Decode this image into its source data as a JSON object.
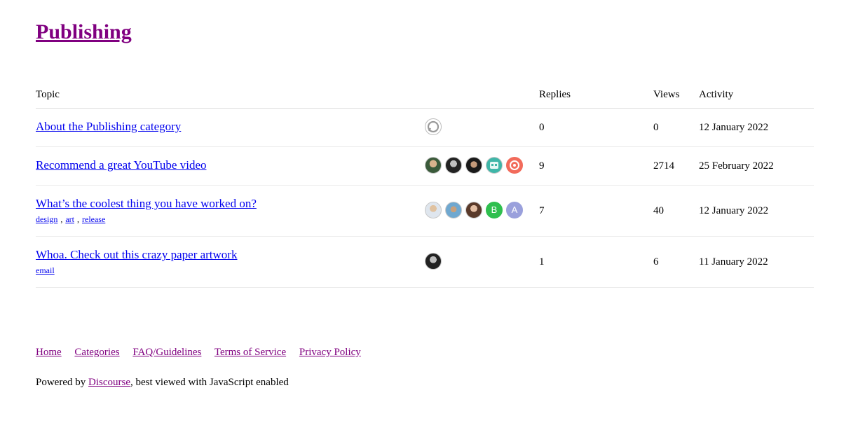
{
  "category": {
    "title": "Publishing"
  },
  "columns": {
    "topic": "Topic",
    "replies": "Replies",
    "views": "Views",
    "activity": "Activity"
  },
  "topics": [
    {
      "title": "About the Publishing category",
      "tags": [],
      "replies": "0",
      "views": "0",
      "activity": "12 January 2022",
      "posters": [
        "discourse-logo-avatar"
      ]
    },
    {
      "title": "Recommend a great YouTube video",
      "tags": [],
      "replies": "9",
      "views": "2714",
      "activity": "25 February 2022",
      "posters": [
        "user-photo-avatar",
        "user-photo-avatar",
        "user-photo-avatar",
        "robot-avatar",
        "coral-logo-avatar"
      ]
    },
    {
      "title": "What’s the coolest thing you have worked on?",
      "tags": [
        "design",
        "art",
        "release"
      ],
      "replies": "7",
      "views": "40",
      "activity": "12 January 2022",
      "posters": [
        "user-photo-avatar",
        "user-photo-avatar",
        "user-photo-avatar",
        "letter-avatar",
        "letter-avatar"
      ],
      "letters": [
        "B",
        "A"
      ]
    },
    {
      "title": "Whoa. Check out this crazy paper artwork",
      "tags": [
        "email"
      ],
      "replies": "1",
      "views": "6",
      "activity": "11 January 2022",
      "posters": [
        "user-photo-avatar"
      ]
    }
  ],
  "footer": {
    "links": [
      "Home",
      "Categories",
      "FAQ/Guidelines",
      "Terms of Service",
      "Privacy Policy"
    ],
    "powered_prefix": "Powered by ",
    "powered_link": "Discourse",
    "powered_suffix": ", best viewed with JavaScript enabled"
  },
  "colors": {
    "link": "#0000ee",
    "visited": "#800080",
    "avatar_b": "#2fbf4f",
    "avatar_a": "#9aa0dc",
    "avatar_coral": "#f26b5b",
    "avatar_teal": "#3fb6a8"
  }
}
